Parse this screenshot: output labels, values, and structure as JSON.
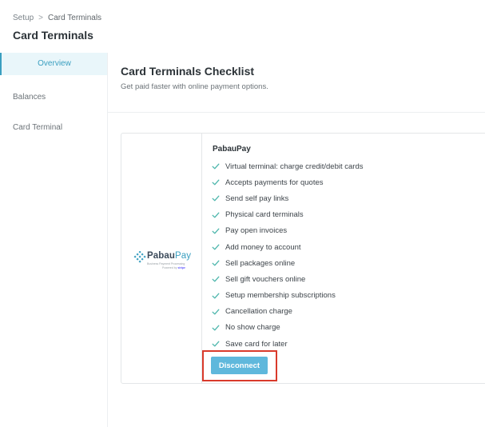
{
  "breadcrumb": {
    "parent": "Setup",
    "separator": ">",
    "current": "Card Terminals"
  },
  "page_title": "Card Terminals",
  "sidebar": {
    "items": [
      {
        "label": "Overview",
        "active": true
      },
      {
        "label": "Balances",
        "active": false
      },
      {
        "label": "Card Terminal",
        "active": false
      }
    ]
  },
  "checklist": {
    "title": "Card Terminals Checklist",
    "subtitle": "Get paid faster with online payment options."
  },
  "provider": {
    "logo": {
      "brand_primary": "Pabau",
      "brand_secondary": "Pay",
      "tagline": "Business Payment Processing",
      "powered_by": "Powered by",
      "powered_by_brand": "stripe"
    },
    "name": "PabauPay",
    "features": [
      "Virtual terminal: charge credit/debit cards",
      "Accepts payments for quotes",
      "Send self pay links",
      "Physical card terminals",
      "Pay open invoices",
      "Add money to account",
      "Sell packages online",
      "Sell gift vouchers online",
      "Setup membership subscriptions",
      "Cancellation charge",
      "No show charge",
      "Save card for later"
    ],
    "disconnect_label": "Disconnect"
  },
  "colors": {
    "accent": "#3a9fc0",
    "button": "#5fb8dc",
    "check": "#4db6ac",
    "highlight_outline": "#d93a2b"
  },
  "icons": {
    "feature_check": "check-icon"
  }
}
